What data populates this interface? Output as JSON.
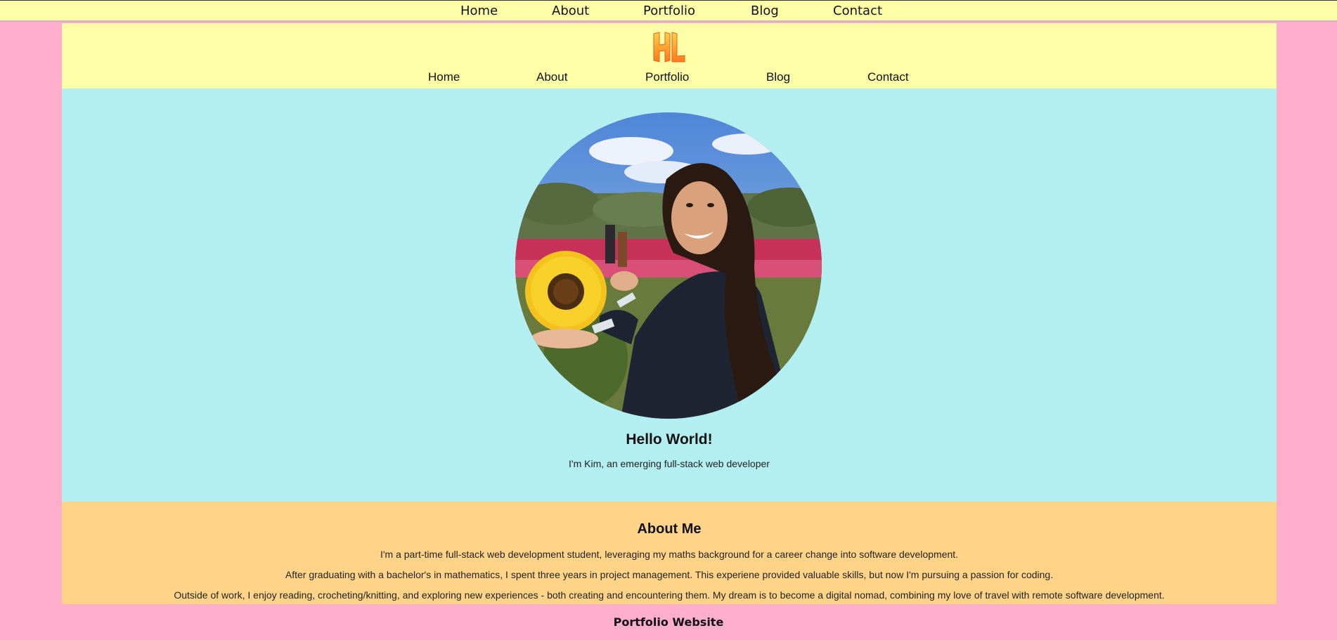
{
  "top_nav": {
    "items": [
      "Home",
      "About",
      "Portfolio",
      "Blog",
      "Contact"
    ]
  },
  "header": {
    "logo_icon": "hl-monogram-logo",
    "nav": [
      "Home",
      "About",
      "Portfolio",
      "Blog",
      "Contact"
    ]
  },
  "hero": {
    "photo_icon": "profile-photo",
    "heading": "Hello World!",
    "subheading": "I'm Kim, an emerging full-stack web developer"
  },
  "about": {
    "heading": "About Me",
    "paragraphs": [
      "I'm a part-time full-stack web development student, leveraging my maths background for a career change into software development.",
      "After graduating with a bachelor's in mathematics, I spent three years in project management. This experiene provided valuable skills, but now I'm pursuing a passion for coding.",
      "Outside of work, I enjoy reading, crocheting/knitting, and exploring new experiences - both creating and encountering them. My dream is to become a digital nomad, combining my love of travel with remote software development."
    ]
  },
  "footer": {
    "text": "Portfolio Website"
  },
  "colors": {
    "page_bg": "#fdaecb",
    "header_bg": "#ffffa8",
    "hero_bg": "#b3eef0",
    "about_bg": "#ffd488"
  }
}
